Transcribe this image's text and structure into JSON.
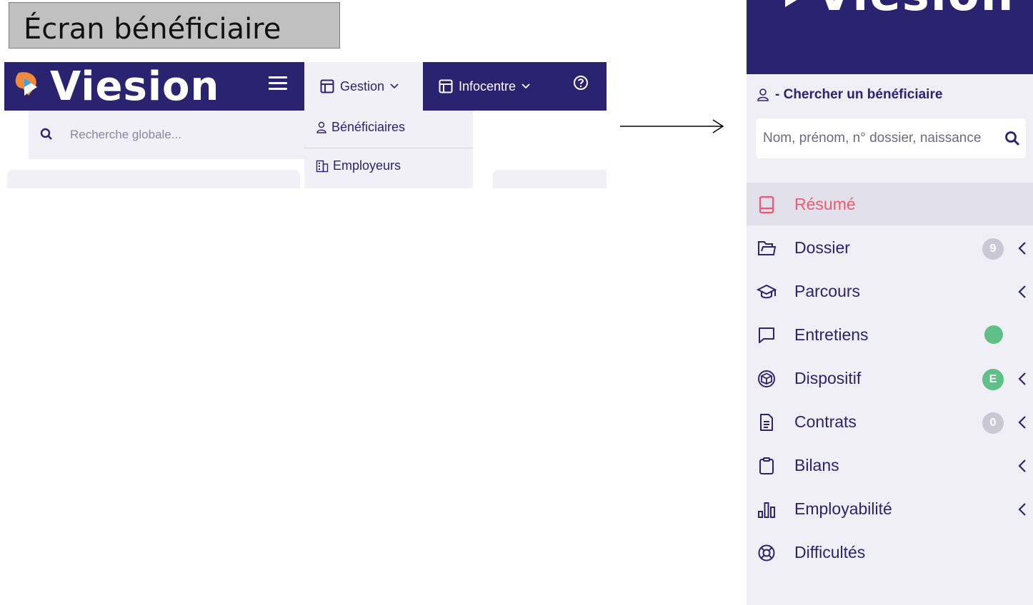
{
  "caption": "Écran bénéficiaire",
  "app": {
    "logo_text": "Viesion",
    "brand_color": "#2a2370",
    "accent_color": "#ee5a6f"
  },
  "topnav": {
    "gestion": "Gestion",
    "infocentre": "Infocentre",
    "help_icon": "help-circle-icon"
  },
  "global_search": {
    "placeholder": "Recherche globale..."
  },
  "gestion_menu": {
    "items": [
      {
        "label": "Bénéficiaires",
        "icon": "user-icon"
      },
      {
        "label": "Employeurs",
        "icon": "building-icon"
      }
    ]
  },
  "sidebar": {
    "search_label": "- Chercher un bénéficiaire",
    "search_placeholder": "Nom, prénom, n° dossier, naissance",
    "items": [
      {
        "label": "Résumé",
        "icon": "book-icon",
        "active": true
      },
      {
        "label": "Dossier",
        "icon": "folder-icon",
        "badge": "9",
        "badge_color": "#c9c8d3",
        "chevron": true
      },
      {
        "label": "Parcours",
        "icon": "graduation-cap-icon",
        "chevron": true
      },
      {
        "label": "Entretiens",
        "icon": "chat-icon",
        "badge": "",
        "badge_color": "#5fbf86"
      },
      {
        "label": "Dispositif",
        "icon": "cube-icon",
        "badge": "E",
        "badge_color": "#5fbf86",
        "chevron": true
      },
      {
        "label": "Contrats",
        "icon": "document-icon",
        "badge": "0",
        "badge_color": "#c9c8d3",
        "chevron": true
      },
      {
        "label": "Bilans",
        "icon": "clipboard-icon",
        "chevron": true
      },
      {
        "label": "Employabilité",
        "icon": "bar-chart-icon",
        "chevron": true
      },
      {
        "label": "Difficultés",
        "icon": "lifebuoy-icon"
      }
    ]
  }
}
